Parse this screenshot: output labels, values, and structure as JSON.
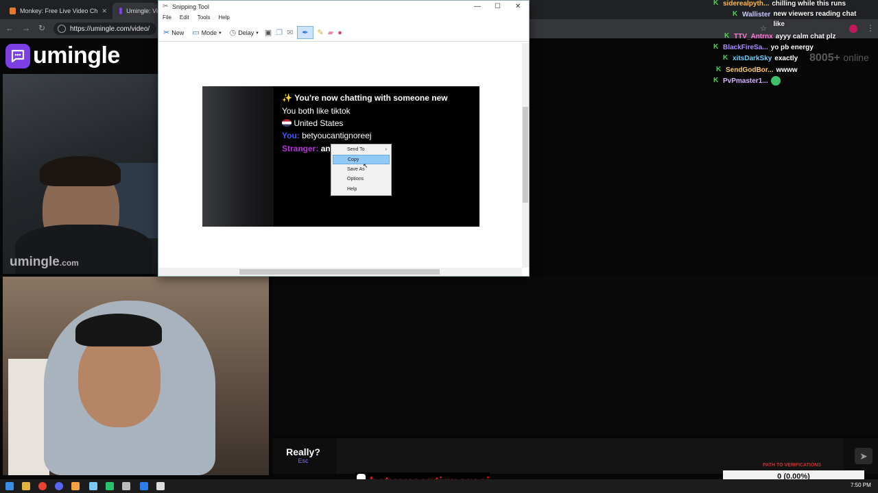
{
  "browser": {
    "tabs": [
      {
        "title": "Monkey: Free Live Video Ch",
        "favicon_color": "#e07a2e",
        "active": false
      },
      {
        "title": "Umingle: Vi",
        "favicon_color": "#7b3fe4",
        "active": true
      }
    ],
    "url": "https://umingle.com/video/"
  },
  "umingle": {
    "logo_text": "umingle",
    "watermark_main": "umingle",
    "watermark_suffix": ".com",
    "online_count": "8005+",
    "online_label": "online",
    "really_label": "Really?",
    "esc_label": "Esc",
    "send_icon": "send-arrow-icon"
  },
  "stream_chat": [
    {
      "user": "siderealpyth...",
      "user_color": "#ffb84d",
      "message": "chilling while this runs"
    },
    {
      "user": "Wallister",
      "user_color": "#c9c9ff",
      "message": "new viewers reading chat like"
    },
    {
      "user": "TTV_Antrnx",
      "user_color": "#ff7ad9",
      "message": "ayyy calm chat plz"
    },
    {
      "user": "BlackFireSa...",
      "user_color": "#a98cff",
      "message": "yo pb energy"
    },
    {
      "user": "xitsDarkSky",
      "user_color": "#6fd0ff",
      "message": "exactly"
    },
    {
      "user": "SendGodBor...",
      "user_color": "#ffcc66",
      "message": "wwww"
    },
    {
      "user": "PvPmaster1...",
      "user_color": "#d9b3ff",
      "message": ""
    }
  ],
  "overlay": {
    "tiktok_handle": "betyoucantignoreej",
    "goal_title": "PATH TO VERIFICATIONS",
    "goal_text": "0 (0.00%)",
    "goal_progress": 0
  },
  "snipping_tool": {
    "title": "Snipping Tool",
    "menu": [
      "File",
      "Edit",
      "Tools",
      "Help"
    ],
    "toolbar": {
      "new": "New",
      "mode": "Mode",
      "delay": "Delay"
    },
    "capture": {
      "line1": "You're now chatting with someone new",
      "line2": "You both like tiktok",
      "line3": "United States",
      "you_label": "You:",
      "you_name": "betyoucantignoreej",
      "stranger_label": "Stranger:",
      "stranger_msg": "an"
    },
    "context_menu": [
      "Send To",
      "Copy",
      "Save As",
      "Options",
      "Help"
    ],
    "context_highlight": "Copy"
  },
  "taskbar": {
    "clock": "7:50 PM"
  }
}
